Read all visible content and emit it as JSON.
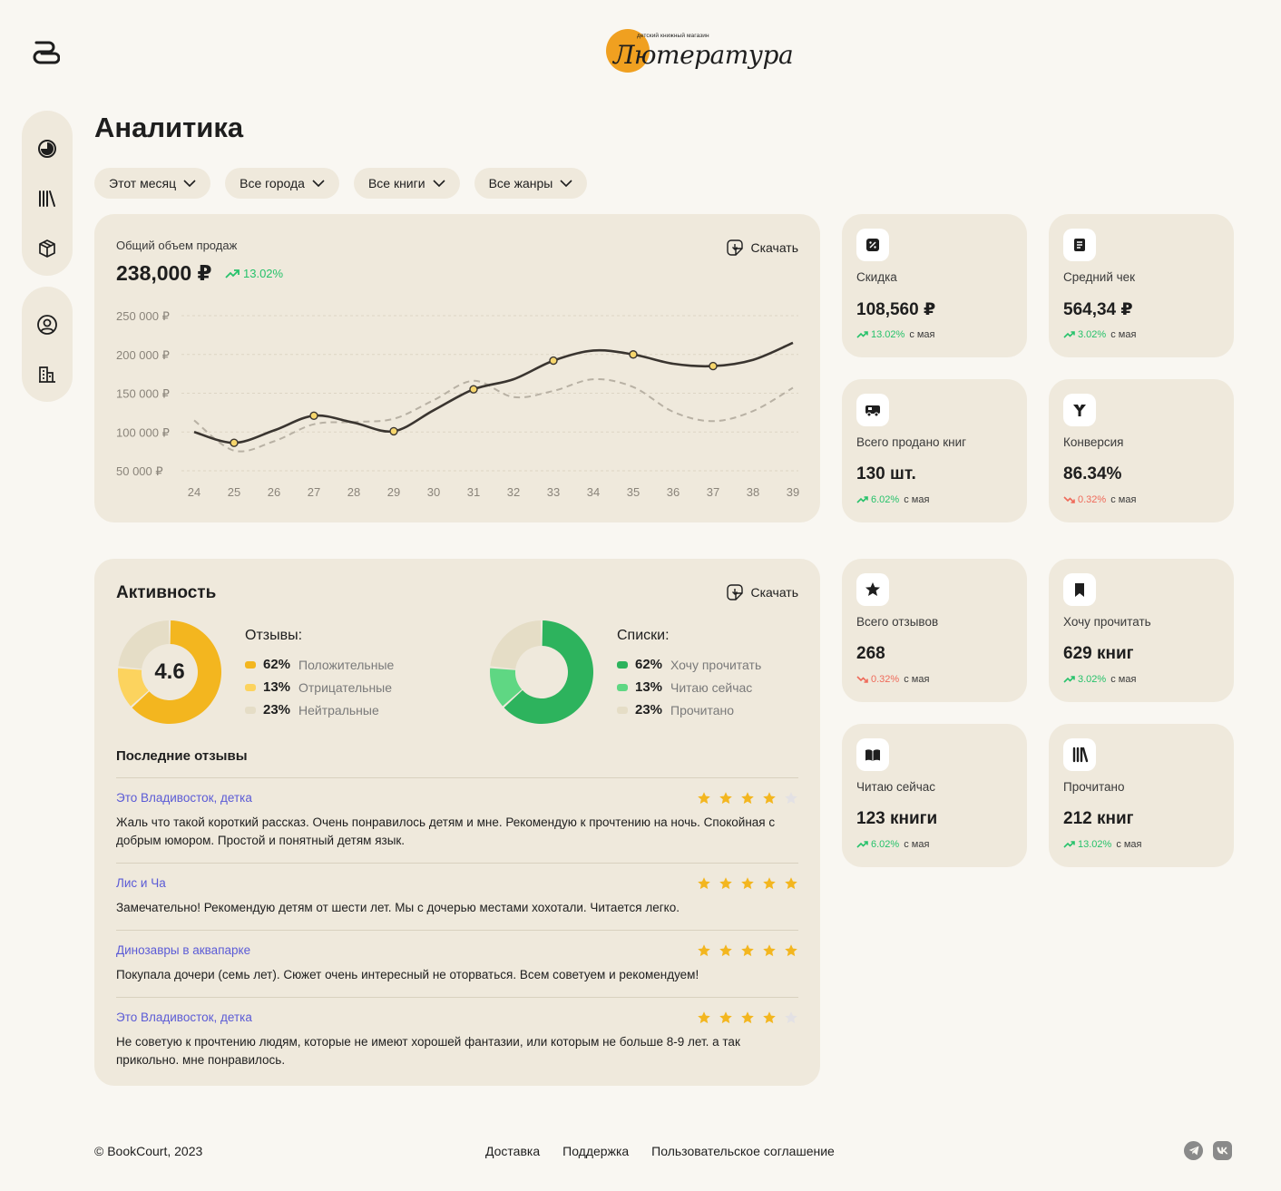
{
  "header": {
    "store_logo_subtitle": "детский книжный магазин",
    "store_logo_name": "Лютература"
  },
  "page": {
    "title": "Аналитика"
  },
  "filters": [
    "Этот месяц",
    "Все города",
    "Все книги",
    "Все жанры"
  ],
  "sales": {
    "label": "Общий объем продаж",
    "value": "238,000 ₽",
    "trend": "13.02%",
    "download_label": "Скачать"
  },
  "chart_data": {
    "type": "line",
    "x": [
      24,
      25,
      26,
      27,
      28,
      29,
      30,
      31,
      32,
      33,
      34,
      35,
      36,
      37,
      38,
      39
    ],
    "y_tick_labels": [
      "250 000 ₽",
      "200 000 ₽",
      "150 000 ₽",
      "100 000 ₽",
      "50 000 ₽"
    ],
    "y_ticks": [
      250000,
      200000,
      150000,
      100000,
      50000
    ],
    "ylim": [
      50000,
      250000
    ],
    "grid": true,
    "series": [
      {
        "style": "solid",
        "color": "#3a3530",
        "values": [
          100000,
          86000,
          102000,
          121000,
          112000,
          101000,
          128000,
          155000,
          168000,
          192000,
          205000,
          200000,
          188000,
          185000,
          193000,
          215000
        ],
        "markers_at": [
          25,
          27,
          29,
          31,
          33,
          35,
          37
        ]
      },
      {
        "style": "dashed",
        "color": "#b8b1a4",
        "values": [
          115000,
          76000,
          88000,
          110000,
          113000,
          117000,
          141000,
          166000,
          145000,
          153000,
          168000,
          158000,
          126000,
          114000,
          127000,
          157000
        ]
      }
    ]
  },
  "stats_top": [
    {
      "icon": "discount-icon",
      "label": "Скидка",
      "value": "108,560 ₽",
      "trend": "13.02%",
      "dir": "up",
      "since": "с мая"
    },
    {
      "icon": "receipt-icon",
      "label": "Средний чек",
      "value": "564,34 ₽",
      "trend": "3.02%",
      "dir": "up",
      "since": "с мая"
    },
    {
      "icon": "truck-icon",
      "label": "Всего продано книг",
      "value": "130 шт.",
      "trend": "6.02%",
      "dir": "up",
      "since": "с мая"
    },
    {
      "icon": "funnel-icon",
      "label": "Конверсия",
      "value": "86.34%",
      "trend": "0.32%",
      "dir": "down",
      "since": "с мая"
    }
  ],
  "stats_bottom": [
    {
      "icon": "star-icon",
      "label": "Всего отзывов",
      "value": "268",
      "trend": "0.32%",
      "dir": "down",
      "since": "с мая"
    },
    {
      "icon": "bookmark-icon",
      "label": "Хочу прочитать",
      "value": "629 книг",
      "trend": "3.02%",
      "dir": "up",
      "since": "с мая"
    },
    {
      "icon": "open-book-icon",
      "label": "Читаю сейчас",
      "value": "123 книги",
      "trend": "6.02%",
      "dir": "up",
      "since": "с мая"
    },
    {
      "icon": "books-icon",
      "label": "Прочитано",
      "value": "212 книг",
      "trend": "13.02%",
      "dir": "up",
      "since": "с мая"
    }
  ],
  "activity": {
    "title": "Активность",
    "download_label": "Скачать",
    "reviews_donut": {
      "center": "4.6",
      "title": "Отзывы:",
      "items": [
        {
          "pct": "62%",
          "value": 62,
          "label": "Положительные",
          "color": "#f3b61f"
        },
        {
          "pct": "13%",
          "value": 13,
          "label": "Отрицательные",
          "color": "#fcd35e"
        },
        {
          "pct": "23%",
          "value": 23,
          "label": "Нейтральные",
          "color": "#e5ddc6"
        }
      ]
    },
    "lists_donut": {
      "title": "Списки:",
      "items": [
        {
          "pct": "62%",
          "value": 62,
          "label": "Хочу прочитать",
          "color": "#2db35d"
        },
        {
          "pct": "13%",
          "value": 13,
          "label": "Читаю сейчас",
          "color": "#5fd783"
        },
        {
          "pct": "23%",
          "value": 23,
          "label": "Прочитано",
          "color": "#e5ddc6"
        }
      ]
    },
    "reviews_title": "Последние отзывы",
    "reviews": [
      {
        "book": "Это Владивосток, детка",
        "rating": 4,
        "text": "Жаль что такой короткий рассказ. Очень понравилось детям и мне. Рекомендую к прочтению на ночь. Спокойная с добрым юмором. Простой и понятный детям язык."
      },
      {
        "book": "Лис и Ча",
        "rating": 5,
        "text": "Замечательно! Рекомендую детям от шести лет. Мы с дочерью местами хохотали. Читается легко."
      },
      {
        "book": "Динозавры в аквапарке",
        "rating": 5,
        "text": "Покупала дочери (семь лет). Сюжет очень интересный не оторваться. Всем советуем и рекомендуем!"
      },
      {
        "book": "Это Владивосток, детка",
        "rating": 4,
        "text": "Не советую к прочтению людям, которые не имеют хорошей фантазии, или которым не больше 8-9 лет. а так прикольно. мне понравилось."
      }
    ]
  },
  "footer": {
    "copyright": "© BookCourt, 2023",
    "links": [
      "Доставка",
      "Поддержка",
      "Пользовательское соглашение"
    ]
  },
  "colors": {
    "background": "#f9f7f2",
    "card": "#efe9dc",
    "link": "#5b5bd6",
    "up": "#27c26b",
    "down": "#ef6a5a",
    "star": "#f3b61f"
  }
}
